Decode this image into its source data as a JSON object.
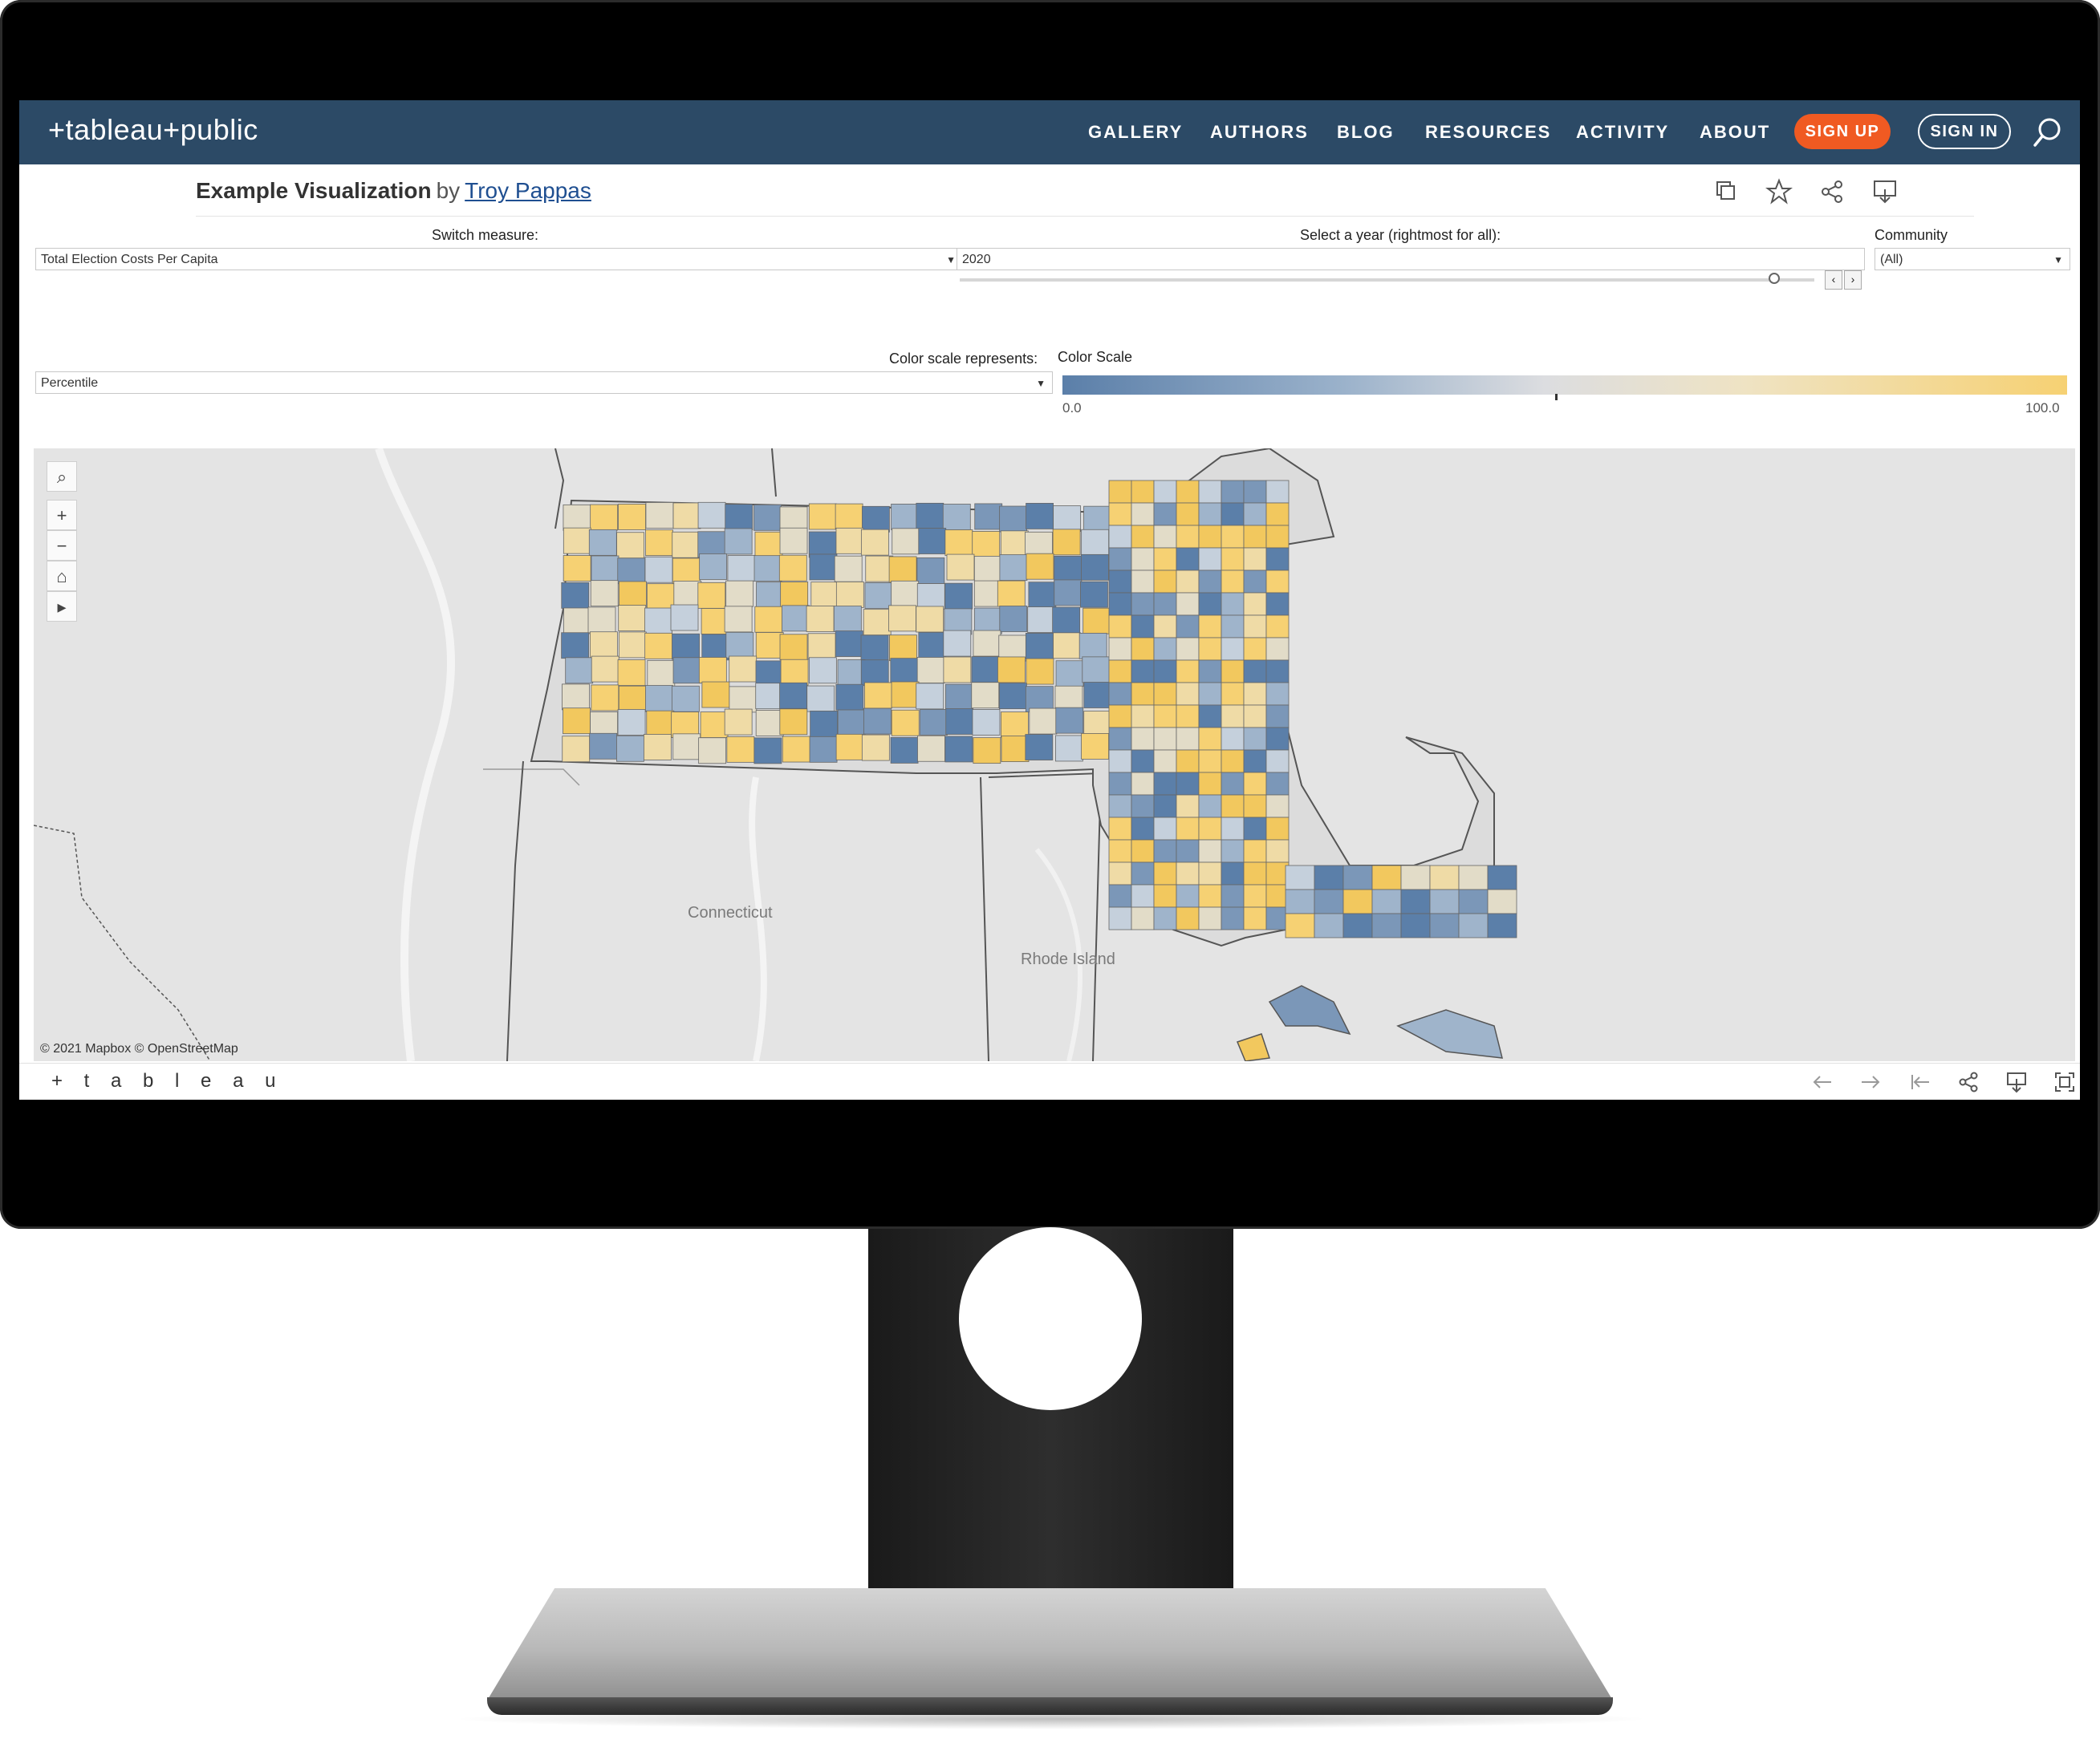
{
  "site": {
    "logo": "+tableau+public",
    "nav": [
      "GALLERY",
      "AUTHORS",
      "BLOG",
      "RESOURCES",
      "ACTIVITY",
      "ABOUT"
    ],
    "signup": "SIGN UP",
    "signin": "SIGN IN"
  },
  "viz": {
    "title": "Example Visualization",
    "by": "by",
    "author": "Troy Pappas"
  },
  "controls": {
    "switch_measure_label": "Switch measure:",
    "switch_measure_value": "Total Election Costs Per Capita",
    "year_label": "Select a year (rightmost for all):",
    "year_value": "2020",
    "community_label": "Community",
    "community_value": "(All)",
    "color_scale_represents_label": "Color scale represents:",
    "color_scale_represents_value": "Percentile",
    "color_scale_label": "Color Scale",
    "scale_min": "0.0",
    "scale_max": "100.0"
  },
  "colors": {
    "nav_bg": "#2c4a66",
    "signup": "#f05a22",
    "scale_low": "#5b7fa9",
    "scale_mid": "#dcdde0",
    "scale_high": "#f6d173"
  },
  "map": {
    "credit": "© 2021 Mapbox © OpenStreetMap",
    "labels": [
      "Connecticut",
      "Rhode Island"
    ]
  },
  "footer": {
    "logo": "+ t a b l e a u"
  }
}
